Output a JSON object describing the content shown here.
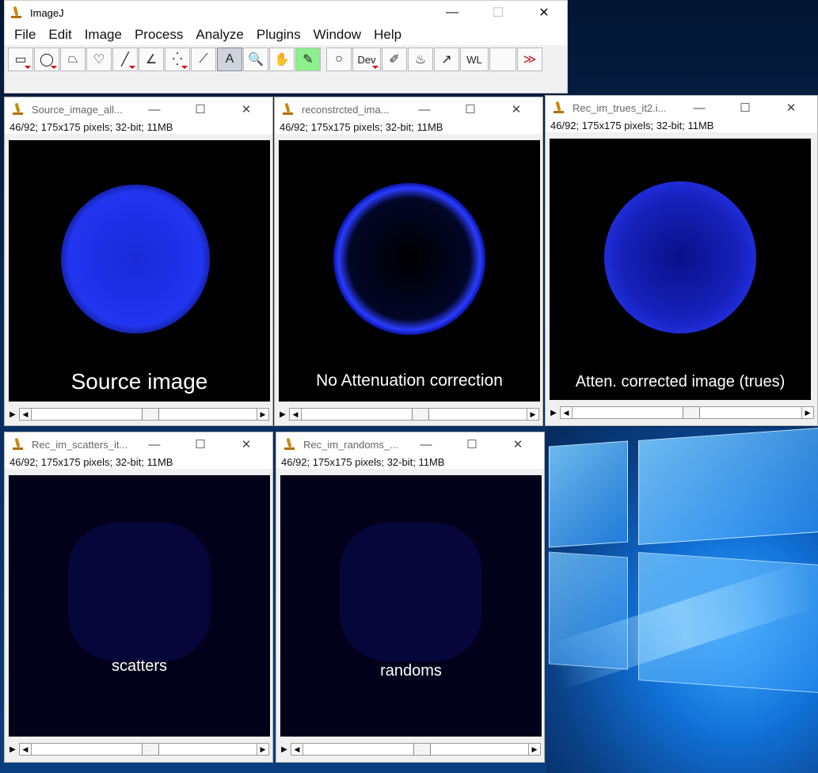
{
  "main": {
    "title": "ImageJ",
    "menus": [
      "File",
      "Edit",
      "Image",
      "Process",
      "Analyze",
      "Plugins",
      "Window",
      "Help"
    ],
    "tools": [
      {
        "name": "rectangle-tool",
        "glyph": "▭",
        "tri": true
      },
      {
        "name": "oval-tool",
        "glyph": "◯",
        "tri": true
      },
      {
        "name": "polygon-tool",
        "glyph": "⏢",
        "tri": false
      },
      {
        "name": "freehand-tool",
        "glyph": "♡",
        "tri": false
      },
      {
        "name": "line-tool",
        "glyph": "╱",
        "tri": true
      },
      {
        "name": "angle-tool",
        "glyph": "∠",
        "tri": false
      },
      {
        "name": "point-tool",
        "glyph": "⁛",
        "tri": true
      },
      {
        "name": "wand-tool",
        "glyph": "⟋",
        "tri": false
      },
      {
        "name": "text-tool",
        "glyph": "A",
        "tri": false,
        "selected": true
      },
      {
        "name": "magnifier-tool",
        "glyph": "🔍",
        "tri": false
      },
      {
        "name": "hand-tool",
        "glyph": "✋",
        "tri": false
      },
      {
        "name": "color-picker-tool",
        "glyph": "✎",
        "tri": false
      }
    ],
    "tools2": [
      {
        "name": "zoom-tool",
        "glyph": "○",
        "tri": false
      },
      {
        "name": "dev-tool",
        "glyph": "Dev",
        "tri": true
      },
      {
        "name": "pencil-tool",
        "glyph": "✐",
        "tri": false
      },
      {
        "name": "flood-fill-tool",
        "glyph": "♨",
        "tri": false
      },
      {
        "name": "arrow-tool",
        "glyph": "↗",
        "tri": false
      },
      {
        "name": "wl-tool",
        "glyph": "WL",
        "tri": false
      },
      {
        "name": "blank-tool",
        "glyph": "",
        "tri": false
      },
      {
        "name": "more-tools",
        "glyph": "≫",
        "tri": false
      }
    ]
  },
  "windows": [
    {
      "id": "w1",
      "title": "Source_image_all...",
      "info": "46/92; 175x175 pixels; 32-bit; 11MB",
      "caption": "Source image",
      "kind": "disk"
    },
    {
      "id": "w2",
      "title": "reconstrcted_ima...",
      "info": "46/92; 175x175 pixels; 32-bit; 11MB",
      "caption": "No Attenuation correction",
      "kind": "ring"
    },
    {
      "id": "w3",
      "title": "Rec_im_trues_it2.i...",
      "info": "46/92; 175x175 pixels; 32-bit; 11MB",
      "caption": "Atten. corrected image (trues)",
      "kind": "mottled"
    },
    {
      "id": "w4",
      "title": "Rec_im_scatters_it...",
      "info": "46/92; 175x175 pixels; 32-bit; 11MB",
      "caption": "scatters",
      "kind": "faint"
    },
    {
      "id": "w5",
      "title": "Rec_im_randoms_...",
      "info": "46/92; 175x175 pixels; 32-bit; 11MB",
      "caption": "randoms",
      "kind": "faint"
    }
  ]
}
